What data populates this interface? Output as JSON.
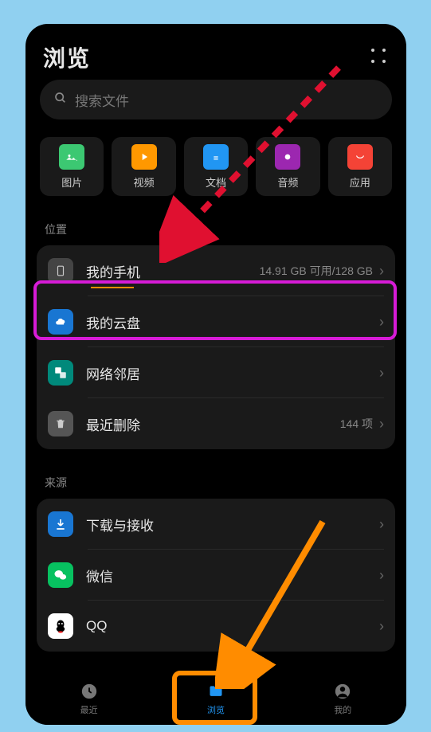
{
  "header": {
    "title": "浏览"
  },
  "search": {
    "placeholder": "搜索文件"
  },
  "categories": [
    {
      "label": "图片"
    },
    {
      "label": "视频"
    },
    {
      "label": "文档"
    },
    {
      "label": "音频"
    },
    {
      "label": "应用"
    }
  ],
  "sections": {
    "location_label": "位置",
    "source_label": "来源"
  },
  "location_items": {
    "my_phone": {
      "label": "我的手机",
      "meta": "14.91 GB 可用/128 GB"
    },
    "my_cloud": {
      "label": "我的云盘"
    },
    "network": {
      "label": "网络邻居"
    },
    "recent_delete": {
      "label": "最近删除",
      "meta": "144 项"
    }
  },
  "source_items": {
    "download": {
      "label": "下载与接收"
    },
    "wechat": {
      "label": "微信"
    },
    "qq": {
      "label": "QQ"
    }
  },
  "nav": {
    "recent": "最近",
    "browse": "浏览",
    "mine": "我的"
  }
}
